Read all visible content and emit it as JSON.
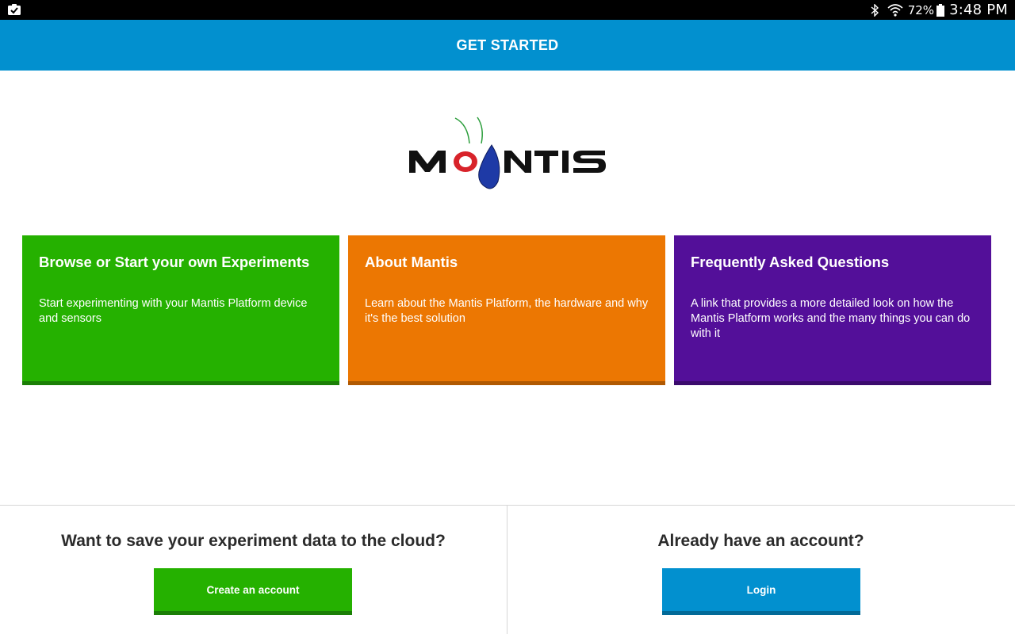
{
  "status_bar": {
    "notification_icon": "clipboard-check-icon",
    "bluetooth_icon": "bluetooth-icon",
    "wifi_icon": "wifi-icon",
    "battery_percent": "72%",
    "battery_icon": "battery-icon",
    "time": "3:48 PM"
  },
  "app_bar": {
    "title": "GET STARTED"
  },
  "logo": {
    "text": "MANTIS",
    "colors": {
      "text": "#111111",
      "red": "#d8232a",
      "blue": "#1e3aa6",
      "antenna": "#2a9d3a"
    }
  },
  "cards": [
    {
      "title": "Browse or Start your own Experiments",
      "description": "Start experimenting with your Mantis Platform device and sensors",
      "color": "#25b100"
    },
    {
      "title": "About Mantis",
      "description": "Learn about the Mantis Platform, the hardware and why it's the best solution",
      "color": "#ec7702"
    },
    {
      "title": "Frequently Asked Questions",
      "description": "A link that provides a more detailed look on how the Mantis Platform works and the many things you can do with it",
      "color": "#530f99"
    }
  ],
  "bottom": {
    "left": {
      "heading": "Want to save your experiment data to the cloud?",
      "button_label": "Create an account"
    },
    "right": {
      "heading": "Already have an account?",
      "button_label": "Login"
    }
  },
  "colors": {
    "app_bar": "#0290cf",
    "primary_green": "#25b100",
    "primary_blue": "#0290cf"
  }
}
